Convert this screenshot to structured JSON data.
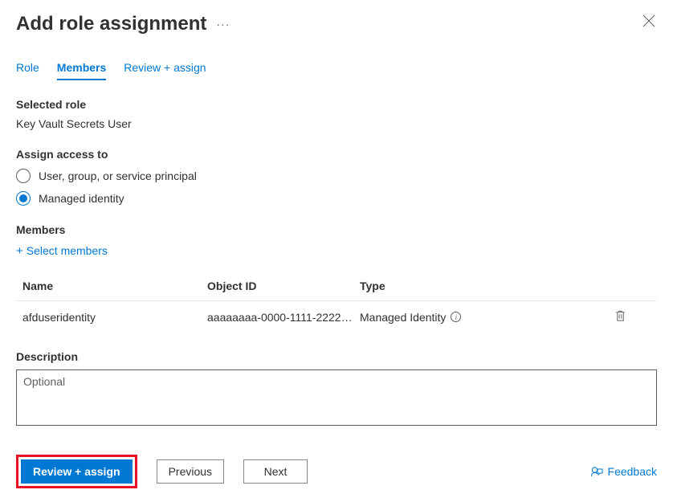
{
  "header": {
    "title": "Add role assignment",
    "more": "···"
  },
  "tabs": {
    "role": "Role",
    "members": "Members",
    "review": "Review + assign"
  },
  "selected_role": {
    "label": "Selected role",
    "value": "Key Vault Secrets User"
  },
  "assign": {
    "label": "Assign access to",
    "option_user": "User, group, or service principal",
    "option_mi": "Managed identity"
  },
  "members": {
    "label": "Members",
    "select_link": "Select members",
    "columns": {
      "name": "Name",
      "object_id": "Object ID",
      "type": "Type"
    },
    "rows": [
      {
        "name": "afduseridentity",
        "object_id": "aaaaaaaa-0000-1111-2222-bb…",
        "type": "Managed Identity"
      }
    ]
  },
  "description": {
    "label": "Description",
    "placeholder": "Optional",
    "value": ""
  },
  "footer": {
    "review": "Review + assign",
    "previous": "Previous",
    "next": "Next",
    "feedback": "Feedback"
  }
}
